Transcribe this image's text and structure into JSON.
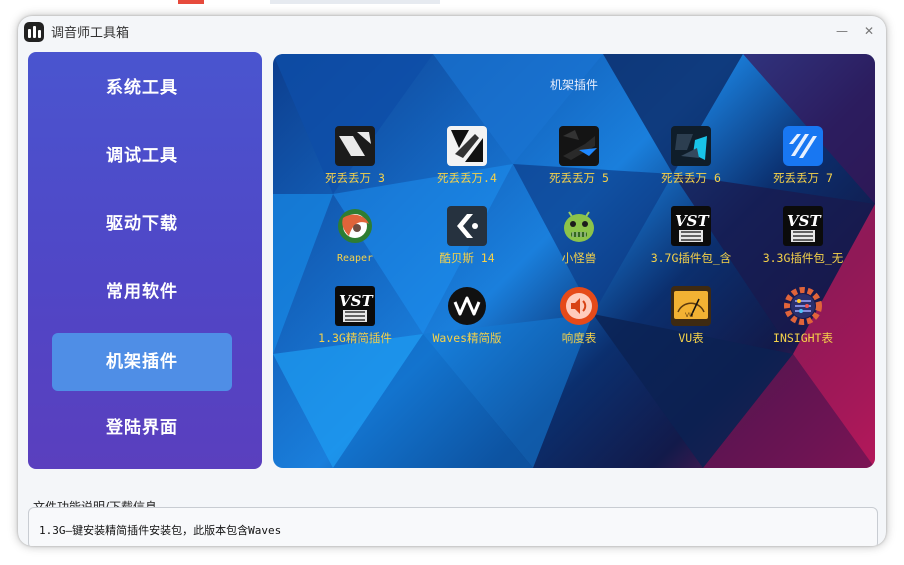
{
  "window": {
    "title": "调音师工具箱"
  },
  "sidebar": {
    "items": [
      {
        "label": "系统工具"
      },
      {
        "label": "调试工具"
      },
      {
        "label": "驱动下载"
      },
      {
        "label": "常用软件"
      },
      {
        "label": "机架插件",
        "active": true
      },
      {
        "label": "登陆界面"
      }
    ]
  },
  "panel": {
    "title": "机架插件",
    "tiles": [
      {
        "label": "死丢丢万 3",
        "icon": "reaper-style-icon"
      },
      {
        "label": "死丢丢万.4",
        "icon": "cubase-style-icon"
      },
      {
        "label": "死丢丢万 5",
        "icon": "cubase-5-icon"
      },
      {
        "label": "死丢丢万 6",
        "icon": "cubase-6-icon"
      },
      {
        "label": "死丢丢万 7",
        "icon": "cubase-7-icon"
      },
      {
        "label": "Reaper",
        "icon": "reaper-icon"
      },
      {
        "label": "酷贝斯 14",
        "icon": "cubase-14-icon"
      },
      {
        "label": "小怪兽",
        "icon": "android-monster-icon"
      },
      {
        "label": "3.7G插件包_含",
        "icon": "vst-icon"
      },
      {
        "label": "3.3G插件包_无",
        "icon": "vst-icon"
      },
      {
        "label": "1.3G精简插件",
        "icon": "vst-icon"
      },
      {
        "label": "Waves精简版",
        "icon": "waves-icon"
      },
      {
        "label": "响度表",
        "icon": "loudness-meter-icon"
      },
      {
        "label": "VU表",
        "icon": "vu-meter-icon"
      },
      {
        "label": "INSIGHT表",
        "icon": "insight-gear-icon"
      }
    ]
  },
  "info": {
    "label": "文件功能说明/下载信息",
    "text": "1.3G—键安装精简插件安装包，此版本包含Waves"
  },
  "colors": {
    "sidebar": "#5046c6",
    "active_item": "#4f8ee6",
    "tile_label": "#f5d24a"
  }
}
